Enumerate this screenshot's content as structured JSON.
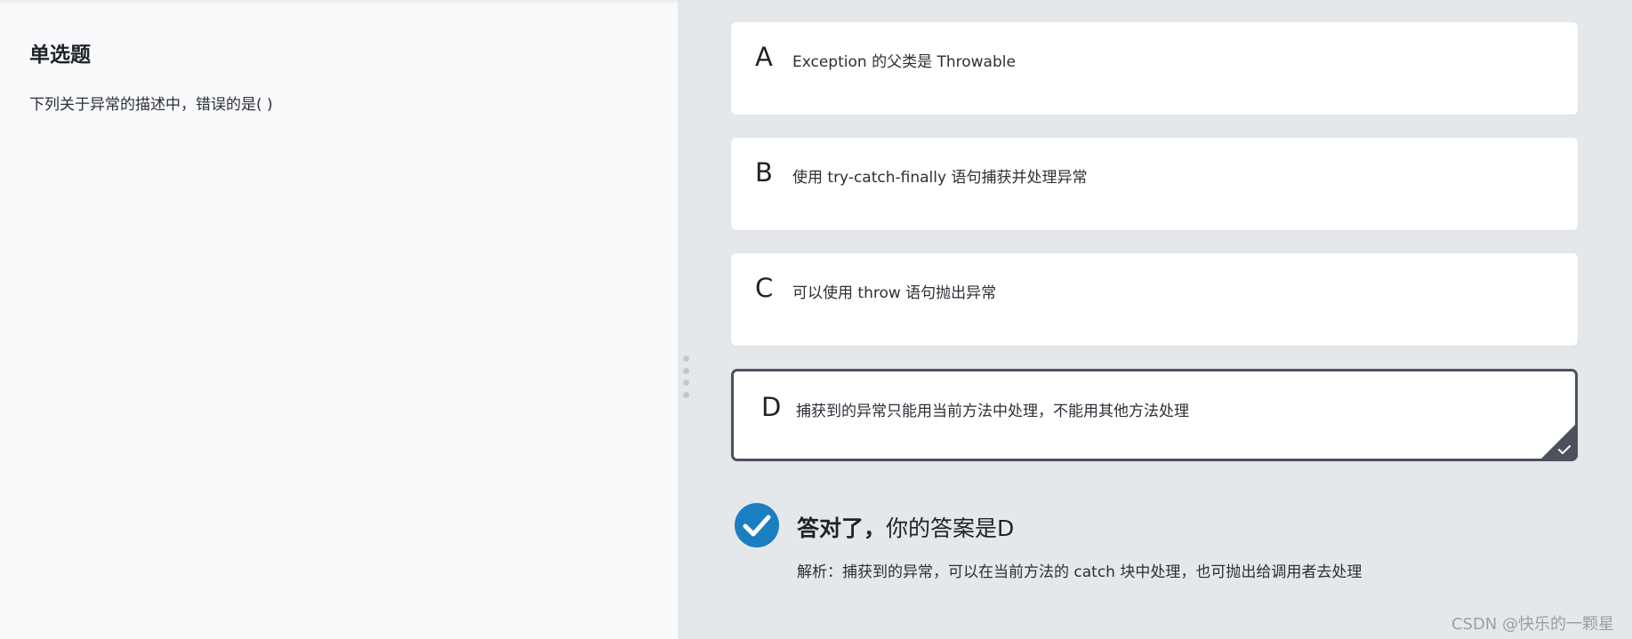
{
  "question": {
    "type": "单选题",
    "text": "下列关于异常的描述中，错误的是( )"
  },
  "options": [
    {
      "letter": "A",
      "text": "Exception 的父类是 Throwable",
      "selected": false
    },
    {
      "letter": "B",
      "text": "使用 try-catch-finally 语句捕获并处理异常",
      "selected": false
    },
    {
      "letter": "C",
      "text": "可以使用 throw 语句抛出异常",
      "selected": false
    },
    {
      "letter": "D",
      "text": "捕获到的异常只能用当前方法中处理，不能用其他方法处理",
      "selected": true
    }
  ],
  "result": {
    "correct_label": "答对了，",
    "answer_text": "你的答案是D",
    "analysis": "解析：捕获到的异常，可以在当前方法的 catch 块中处理，也可抛出给调用者去处理",
    "icon": "check-circle-icon",
    "color": "#1a7fc1"
  },
  "selected_color": "#4b525b",
  "watermark": "CSDN @快乐的一颗星"
}
